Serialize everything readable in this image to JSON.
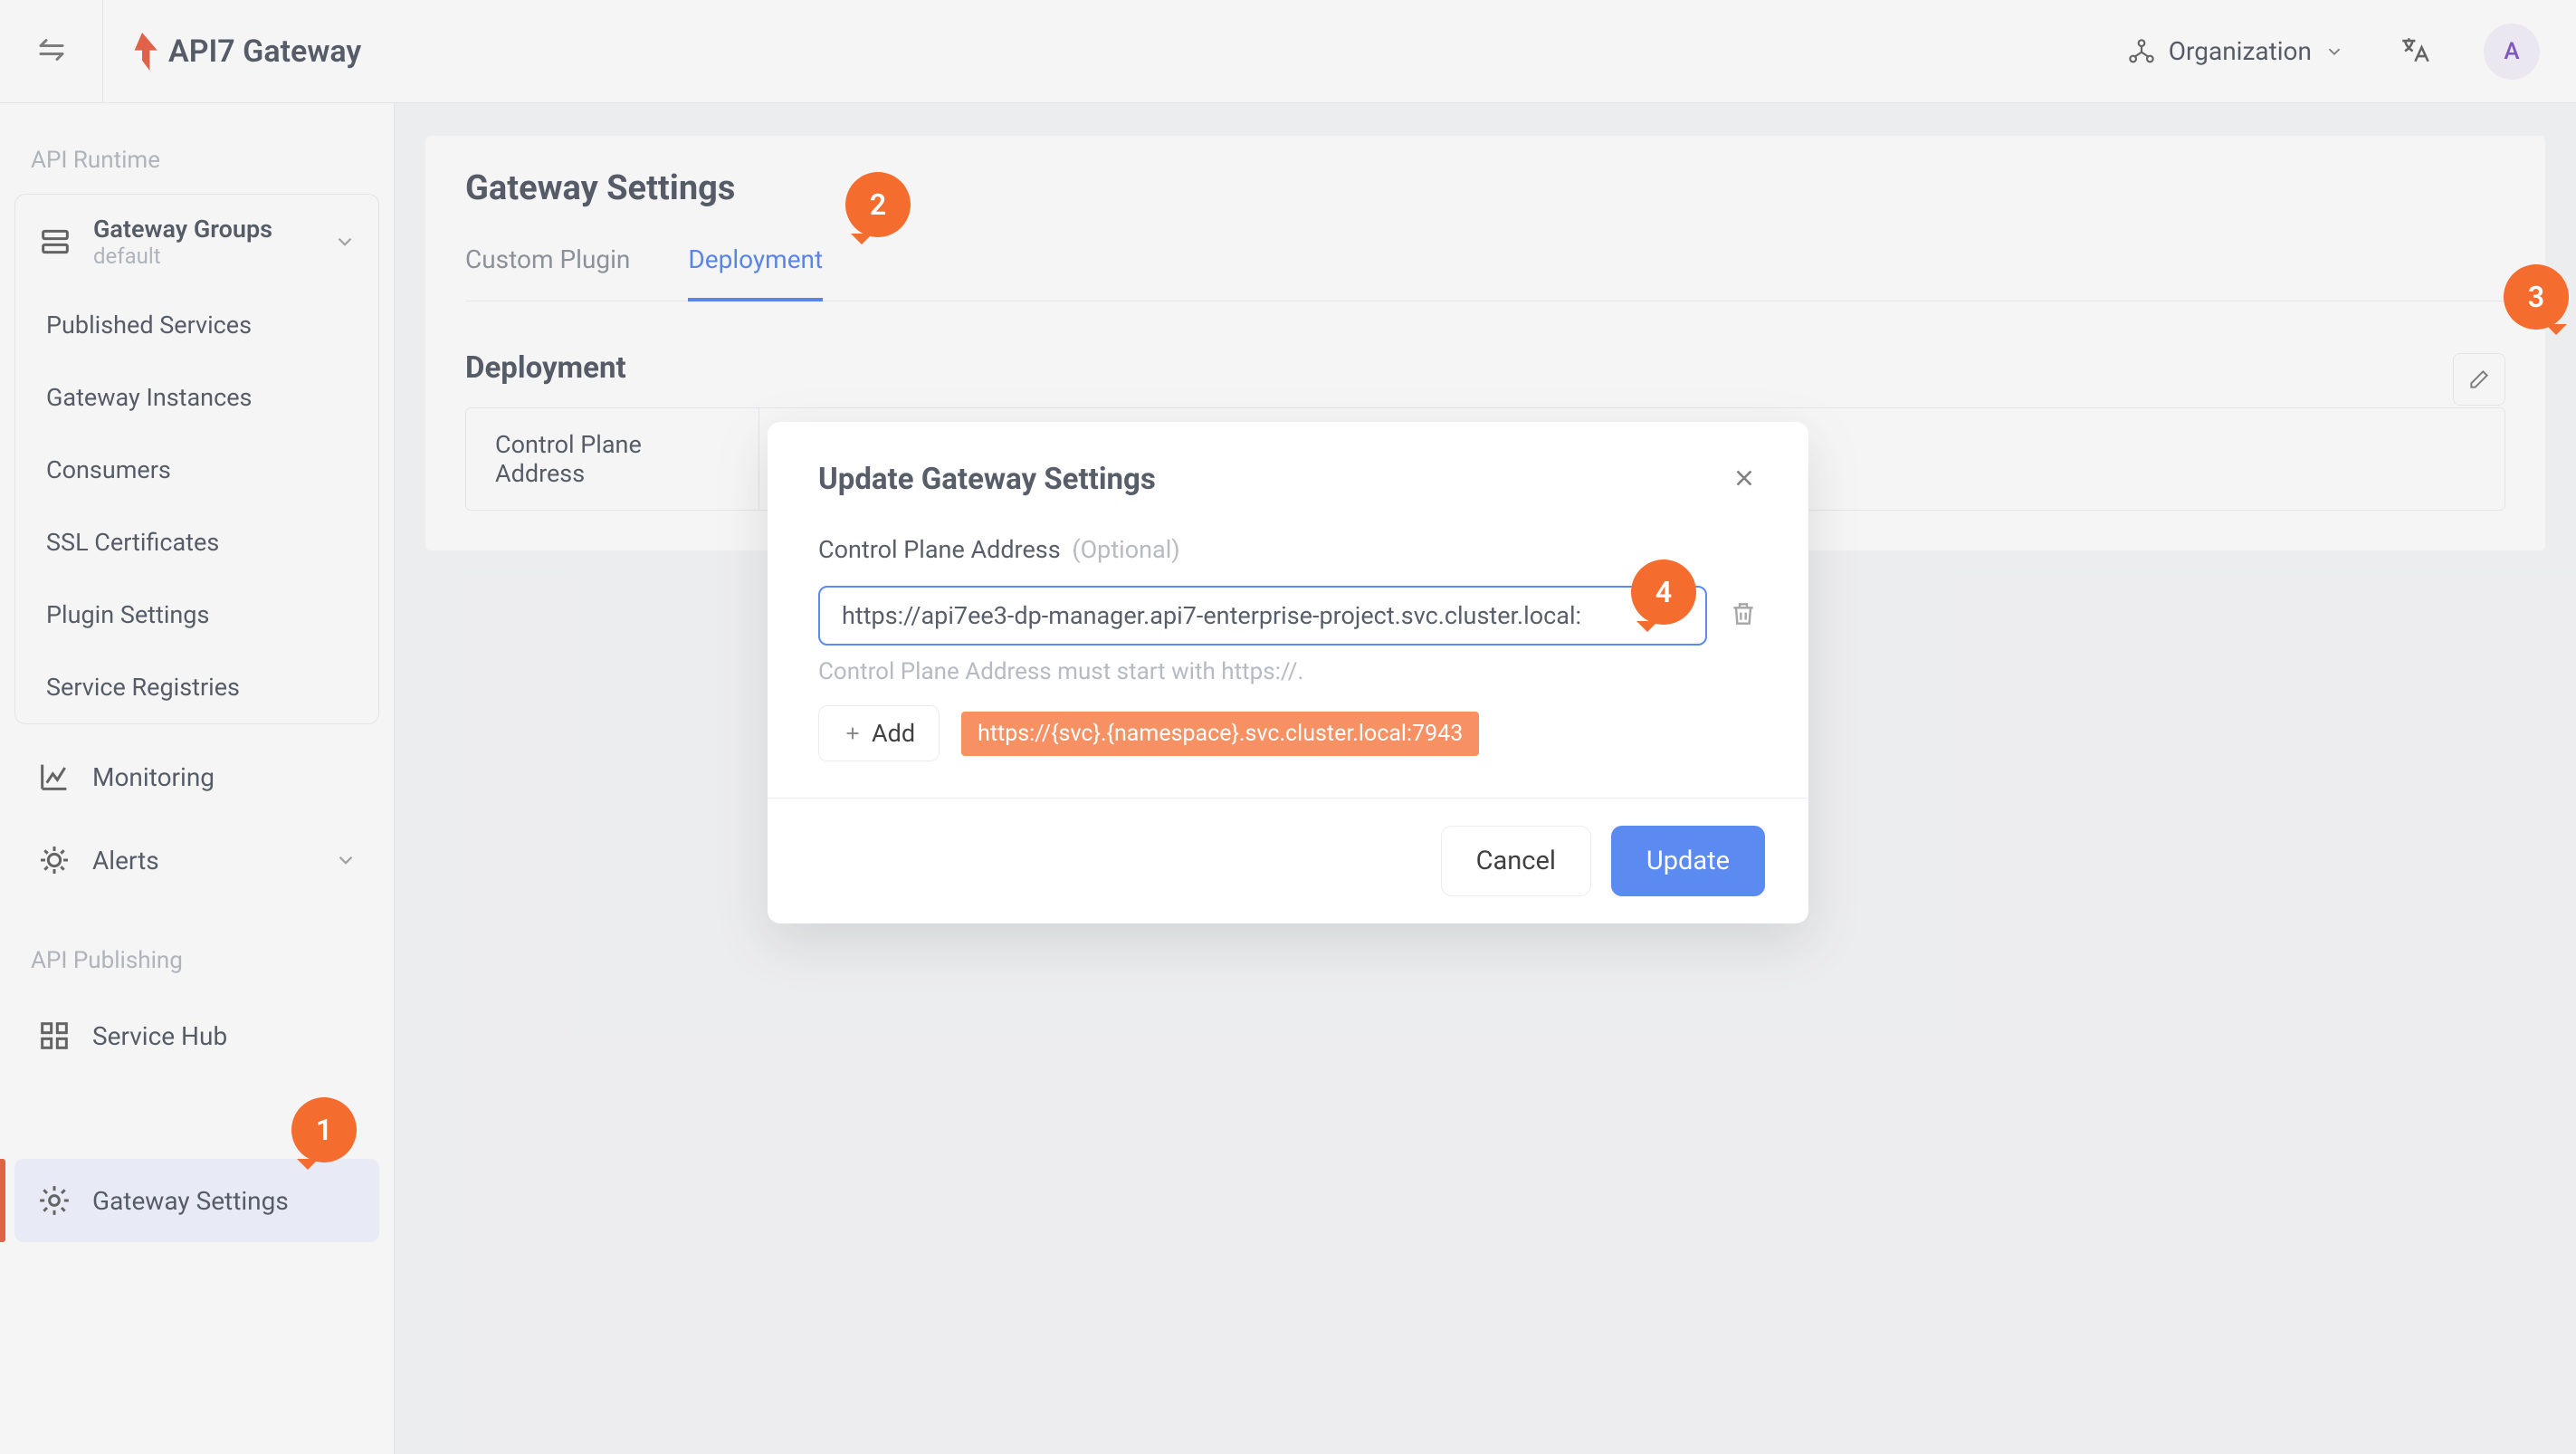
{
  "brand": {
    "name": "API7 Gateway"
  },
  "topbar": {
    "organization_label": "Organization",
    "avatar_initial": "A"
  },
  "sidebar": {
    "section_runtime": "API Runtime",
    "section_publishing": "API Publishing",
    "groups_title": "Gateway Groups",
    "groups_sub": "default",
    "group_items": {
      "published": "Published Services",
      "instances": "Gateway Instances",
      "consumers": "Consumers",
      "ssl": "SSL Certificates",
      "plugin_settings": "Plugin Settings",
      "registries": "Service Registries"
    },
    "monitoring": "Monitoring",
    "alerts": "Alerts",
    "service_hub": "Service Hub",
    "gateway_settings": "Gateway Settings"
  },
  "main": {
    "title": "Gateway Settings",
    "tab_custom_plugin": "Custom Plugin",
    "tab_deployment": "Deployment",
    "section_deployment": "Deployment",
    "row_label": "Control Plane Address"
  },
  "modal": {
    "title": "Update Gateway Settings",
    "field_label": "Control Plane Address",
    "field_optional": "(Optional)",
    "field_value": "https://api7ee3-dp-manager.api7-enterprise-project.svc.cluster.local:",
    "field_hint": "Control Plane Address must start with https://.",
    "add_label": "Add",
    "chip": "https://{svc}.{namespace}.svc.cluster.local:7943",
    "cancel": "Cancel",
    "update": "Update"
  },
  "bubbles": {
    "b1": "1",
    "b2": "2",
    "b3": "3",
    "b4": "4"
  }
}
